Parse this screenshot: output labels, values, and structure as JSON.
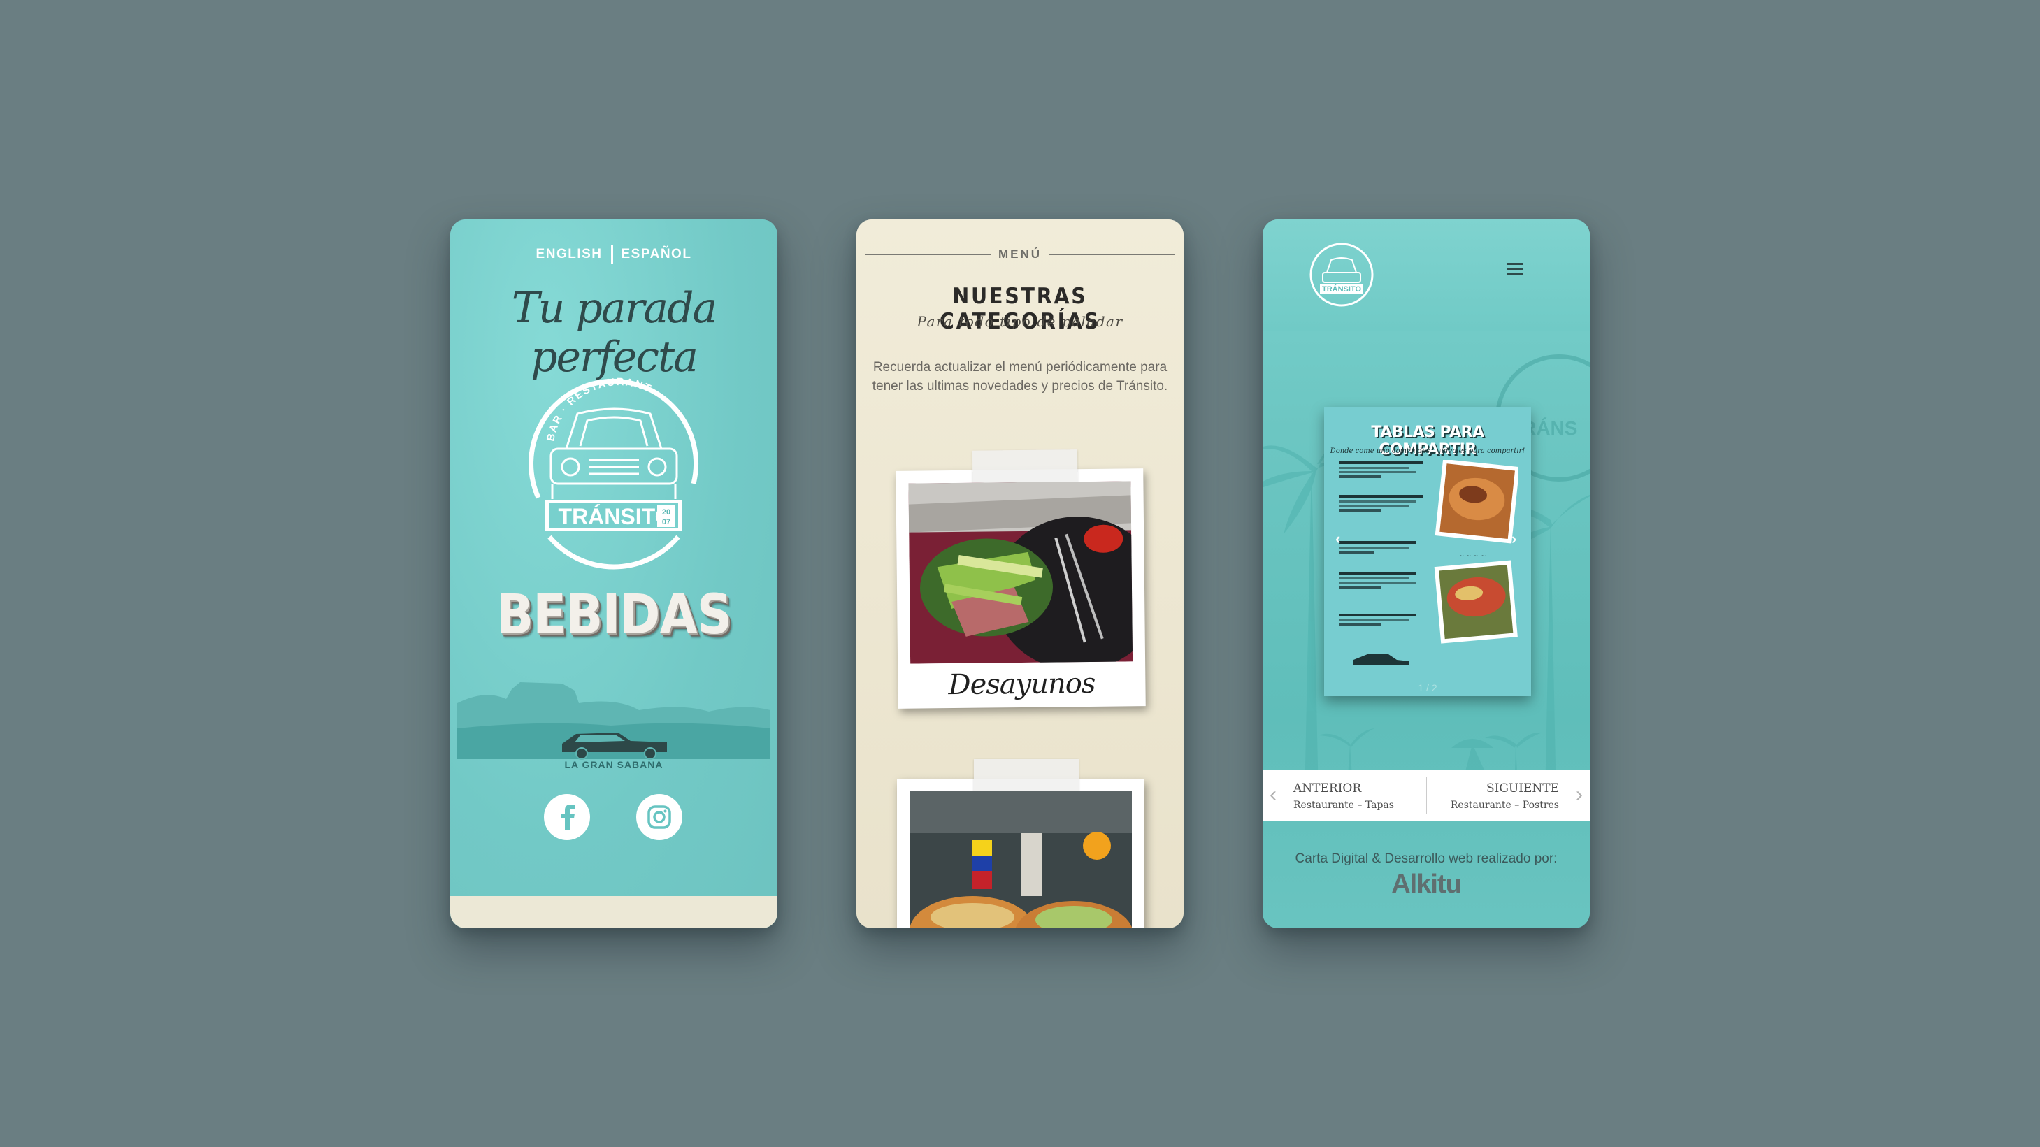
{
  "phone1": {
    "lang_en": "ENGLISH",
    "lang_es": "ESPAÑOL",
    "tagline": "Tu parada perfecta",
    "logo_arc": "BAR · RESTAURANTE",
    "logo_name": "TRÁNSITO",
    "logo_year_top": "20",
    "logo_year_bottom": "07",
    "section": "BEBIDAS",
    "landscape_caption": "LA GRAN SABANA",
    "social": [
      "facebook-icon",
      "instagram-icon"
    ]
  },
  "phone2": {
    "menu_label": "MENÚ",
    "title": "NUESTRAS CATEGORÍAS",
    "subtitle": "Para todo tipo de paladar",
    "description": "Recuerda actualizar el menú periódicamente para tener las ultimas novedades y precios de Tránsito.",
    "categories": [
      {
        "caption": "Desayunos"
      }
    ]
  },
  "phone3": {
    "logo_name": "TRÁNSITO",
    "watermark_text": "TRÁNS",
    "menu_card": {
      "title": "TABLAS PARA COMPARTIR",
      "subtitle": "Donde come uno comen dos... ¡ideales para compartir!",
      "counter": "1 / 2"
    },
    "nav": {
      "prev_label": "ANTERIOR",
      "prev_sub": "Restaurante – Tapas",
      "next_label": "SIGUIENTE",
      "next_sub": "Restaurante – Postres"
    },
    "credit": "Carta Digital & Desarrollo web realizado por:",
    "brand": "Alkitu"
  },
  "colors": {
    "background": "#6a7e82",
    "teal": "#78d0cd",
    "cream": "#ede7d2"
  }
}
